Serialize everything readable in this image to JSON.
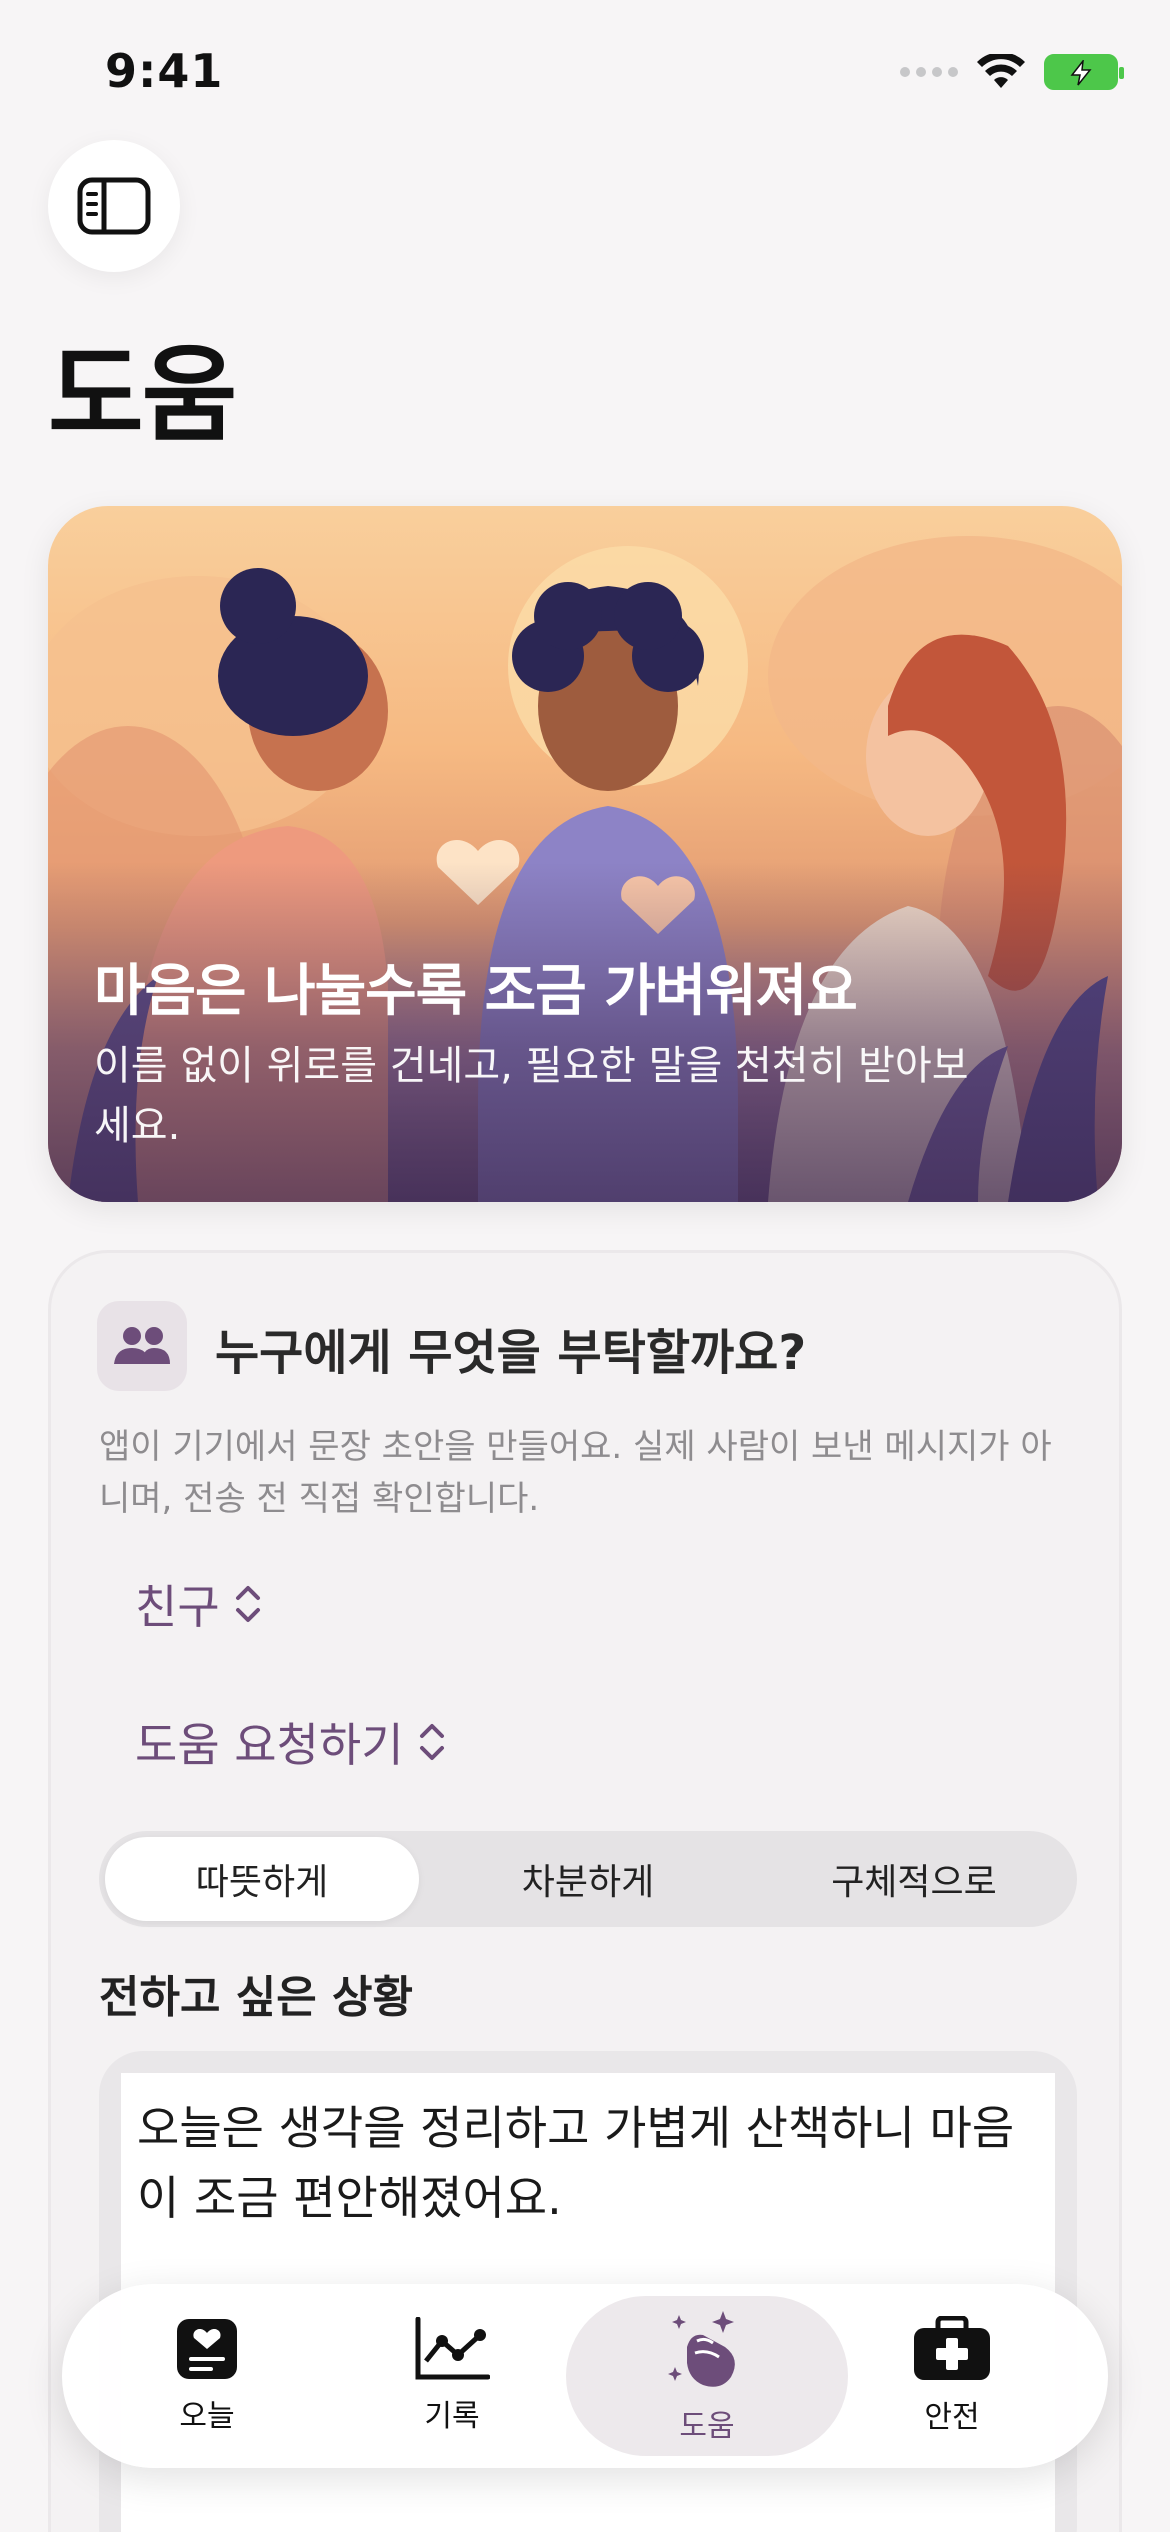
{
  "status_bar": {
    "time": "9:41"
  },
  "header": {
    "title": "도움"
  },
  "hero": {
    "title": "마음은 나눌수록 조금 가벼워져요",
    "subtitle": "이름 없이 위로를 건네고, 필요한 말을 천천히 받아보세요."
  },
  "request": {
    "title": "누구에게 무엇을 부탁할까요?",
    "description": "앱이 기기에서 문장 초안을 만들어요. 실제 사람이 보낸 메시지가 아니며, 전송 전 직접 확인합니다.",
    "recipient": "친구",
    "request_type": "도움 요청하기",
    "tones": [
      "따뜻하게",
      "차분하게",
      "구체적으로"
    ],
    "selected_tone": "따뜻하게",
    "situation_label": "전하고 싶은 상황",
    "situation_text": "오늘은 생각을 정리하고 가볍게 산책하니 마음이 조금 편안해졌어요."
  },
  "tabs": [
    {
      "label": "오늘",
      "icon": "heart-note-icon"
    },
    {
      "label": "기록",
      "icon": "chart-line-icon"
    },
    {
      "label": "도움",
      "icon": "clapping-hands-icon"
    },
    {
      "label": "안전",
      "icon": "first-aid-kit-icon"
    }
  ],
  "active_tab": "도움",
  "colors": {
    "accent": "#6d4d7a",
    "background": "#f7f5f6",
    "battery": "#4dc74a"
  }
}
